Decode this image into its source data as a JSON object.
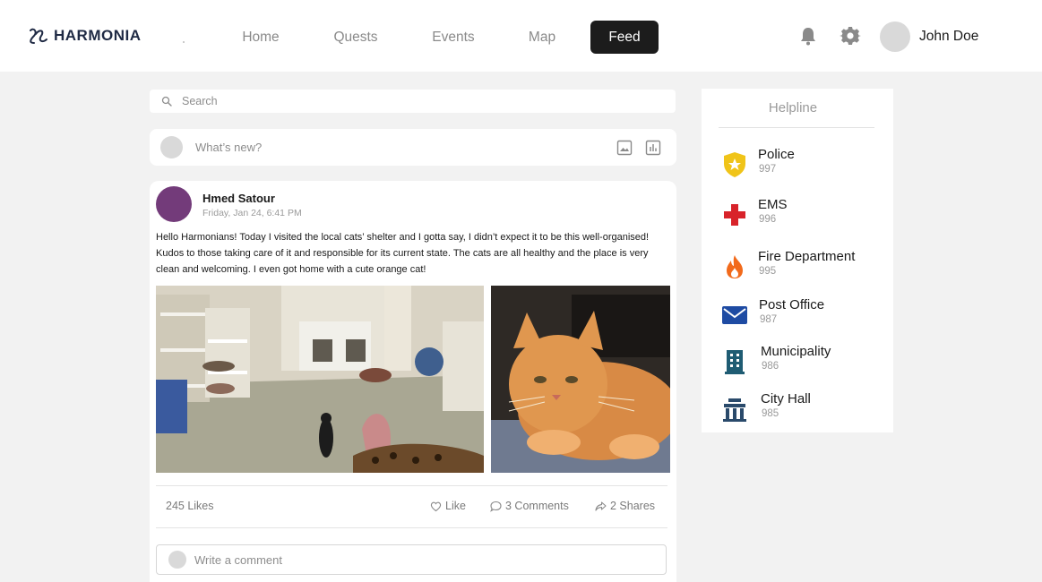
{
  "app": {
    "logo_text": "HARMONIA"
  },
  "nav": {
    "items": [
      {
        "label": "Home"
      },
      {
        "label": "Quests"
      },
      {
        "label": "Events"
      },
      {
        "label": "Map"
      },
      {
        "label": "Feed",
        "active": true
      }
    ]
  },
  "header": {
    "icons": [
      "bell-icon",
      "gear-icon"
    ],
    "user_name": "John Doe"
  },
  "search": {
    "placeholder": "Search"
  },
  "composer": {
    "placeholder": "What’s new?",
    "icons": [
      "image-icon",
      "poll-icon"
    ]
  },
  "post": {
    "author": "Hmed Satour",
    "date": "Friday, Jan 24, 6:41 PM",
    "body": "Hello Harmonians! Today I visited the local cats’ shelter and I gotta say, I didn’t expect it to be this well-organised! Kudos to those taking care of it and responsible for its current state. The cats are all healthy and the place is very clean and welcoming. I even got home with a cute orange cat!",
    "likes": "245 Likes",
    "actions": {
      "like": "Like",
      "comments": "3 Comments",
      "shares": "2 Shares"
    },
    "comment_placeholder": "Write a comment"
  },
  "helpline": {
    "title": "Helpline",
    "items": [
      {
        "name": "Police",
        "number": "997",
        "icon": "police-shield-icon",
        "color": "#f0c419"
      },
      {
        "name": "EMS",
        "number": "996",
        "icon": "medical-cross-icon",
        "color": "#d8232a"
      },
      {
        "name": "Fire Department",
        "number": "995",
        "icon": "fire-icon",
        "color": "#f26a1b"
      },
      {
        "name": "Post Office",
        "number": "987",
        "icon": "mail-icon",
        "color": "#1e4ba3"
      },
      {
        "name": "Municipality",
        "number": "986",
        "icon": "building-icon",
        "color": "#1f5c73"
      },
      {
        "name": "City Hall",
        "number": "985",
        "icon": "city-hall-icon",
        "color": "#2a4a6b"
      }
    ]
  },
  "colors": {
    "nav_active_bg": "#1c1c1c",
    "page_bg": "#f2f2f2",
    "author_avatar": "#733b7a"
  }
}
